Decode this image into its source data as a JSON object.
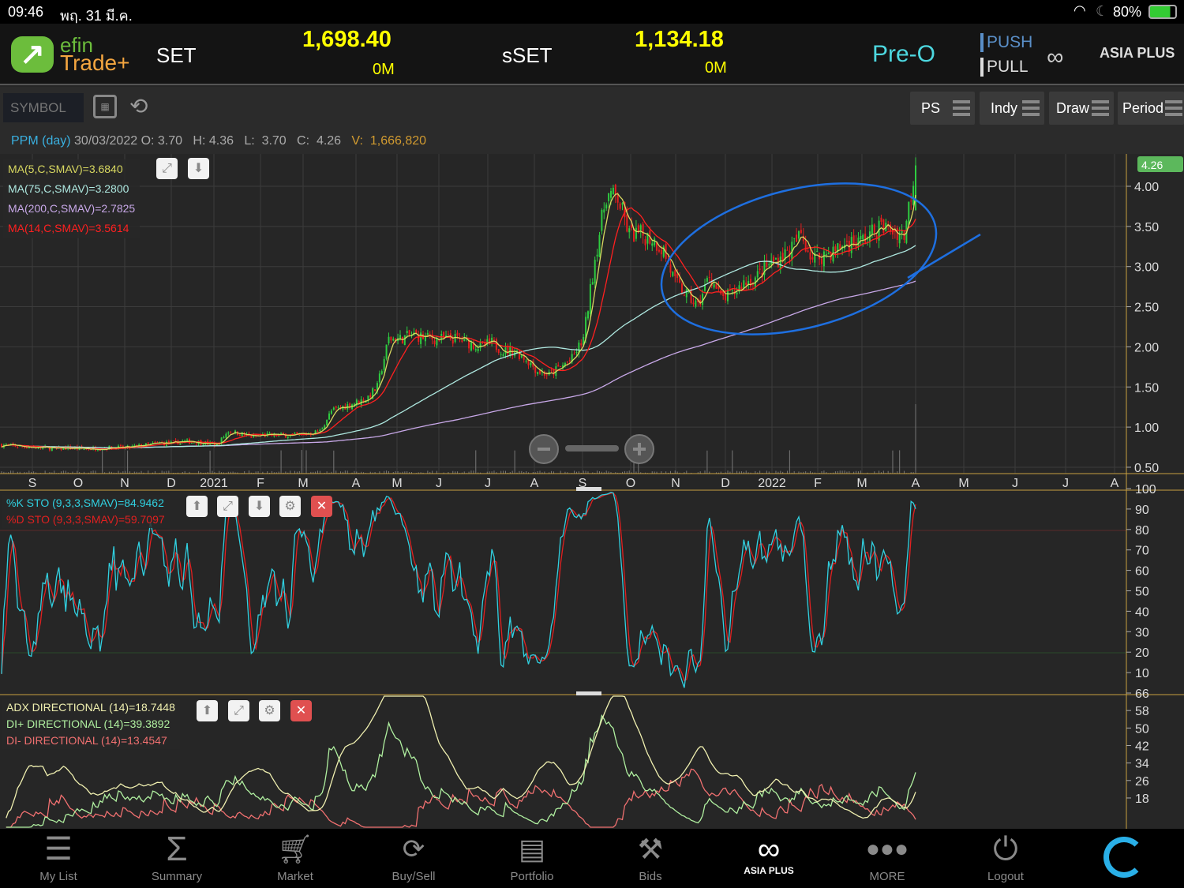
{
  "status_bar": {
    "time": "09:46",
    "date": "พฤ. 31 มี.ค.",
    "battery": "80%"
  },
  "header": {
    "logo_top": "efin",
    "logo_bottom": "Trade+",
    "index1_name": "SET",
    "index1_value": "1,698.40",
    "index1_volume": "0M",
    "index2_name": "sSET",
    "index2_value": "1,134.18",
    "index2_volume": "0M",
    "session": "Pre-O",
    "push": "PUSH",
    "pull": "PULL",
    "broker_logo": "ASIA PLUS"
  },
  "toolbar": {
    "symbol_placeholder": "SYMBOL",
    "buttons": [
      "PS",
      "Indy",
      "Draw",
      "Period"
    ]
  },
  "info": {
    "symbol": "PPM (day)",
    "date": "30/03/2022",
    "o_label": "O:",
    "o": "3.70",
    "h_label": "H:",
    "h": "4.36",
    "l_label": "L:",
    "l": "3.70",
    "c_label": "C:",
    "c": "4.26",
    "v_label": "V:",
    "v": "1,666,820"
  },
  "colors": {
    "up": "#2ecc40",
    "down": "#e41e1e",
    "ma5": "#d8d860",
    "ma75": "#aee8e0",
    "ma200": "#c8a8e8",
    "ma14": "#ff2020",
    "stoK": "#30d0e0",
    "stoD": "#e02020",
    "adx": "#f0f0b0",
    "diplus": "#b0f0a0",
    "diminus": "#f07070",
    "drawing": "#1e6fe0"
  },
  "chart_data": {
    "type": "candlestick",
    "title": "PPM (day)",
    "x_tick_labels": [
      "S",
      "O",
      "N",
      "D",
      "2021",
      "F",
      "M",
      "A",
      "M",
      "J",
      "J",
      "A",
      "S",
      "O",
      "N",
      "D",
      "2022",
      "F",
      "M",
      "A",
      "M",
      "J",
      "J",
      "A"
    ],
    "weekly_close": [
      0.78,
      0.77,
      0.76,
      0.75,
      0.74,
      0.73,
      0.74,
      0.73,
      0.73,
      0.74,
      0.75,
      0.74,
      0.76,
      0.78,
      0.8,
      0.8,
      0.82,
      0.82,
      0.8,
      0.78,
      0.95,
      0.92,
      0.88,
      0.9,
      0.9,
      0.9,
      0.9,
      0.92,
      0.95,
      1.2,
      1.25,
      1.3,
      1.35,
      1.5,
      2.1,
      2.1,
      2.15,
      2.12,
      2.1,
      2.1,
      2.1,
      2.05,
      2.0,
      2.05,
      1.95,
      1.95,
      1.85,
      1.7,
      1.65,
      1.75,
      1.85,
      2.1,
      3.1,
      3.9,
      3.85,
      3.4,
      3.4,
      3.35,
      3.2,
      2.8,
      2.65,
      2.5,
      2.9,
      2.6,
      2.65,
      2.8,
      2.85,
      3.0,
      3.1,
      3.2,
      3.4,
      3.1,
      3.15,
      3.2,
      3.3,
      3.3,
      3.4,
      3.5,
      3.45,
      3.4,
      4.26
    ],
    "y_ticks": [
      "4.00",
      "3.50",
      "3.00",
      "2.50",
      "2.00",
      "1.50",
      "1.00",
      "0.50"
    ],
    "ylim": [
      0.5,
      4.0
    ],
    "last_price": "4.26",
    "overlays": [
      "MA(5,C,SMAV)=3.6840",
      "MA(75,C,SMAV)=3.2800",
      "MA(200,C,SMAV)=2.7825",
      "MA(14,C,SMAV)=3.5614"
    ],
    "stochastic": {
      "legend": [
        "%K STO (9,3,3,SMAV)=84.9462",
        "%D STO (9,3,3,SMAV)=59.7097"
      ],
      "y_ticks": [
        "100",
        "90",
        "80",
        "70",
        "60",
        "50",
        "40",
        "30",
        "20",
        "10"
      ],
      "ylim": [
        0,
        100
      ]
    },
    "adx": {
      "legend": [
        "ADX DIRECTIONAL (14)=18.7448",
        "DI+ DIRECTIONAL (14)=39.3892",
        "DI- DIRECTIONAL (14)=13.4547"
      ],
      "y_ticks": [
        "66",
        "58",
        "50",
        "42",
        "34",
        "26",
        "18"
      ]
    }
  },
  "nav": [
    "My List",
    "Summary",
    "Market",
    "Buy/Sell",
    "Portfolio",
    "Bids",
    "ASIA PLUS",
    "MORE",
    "Logout"
  ]
}
